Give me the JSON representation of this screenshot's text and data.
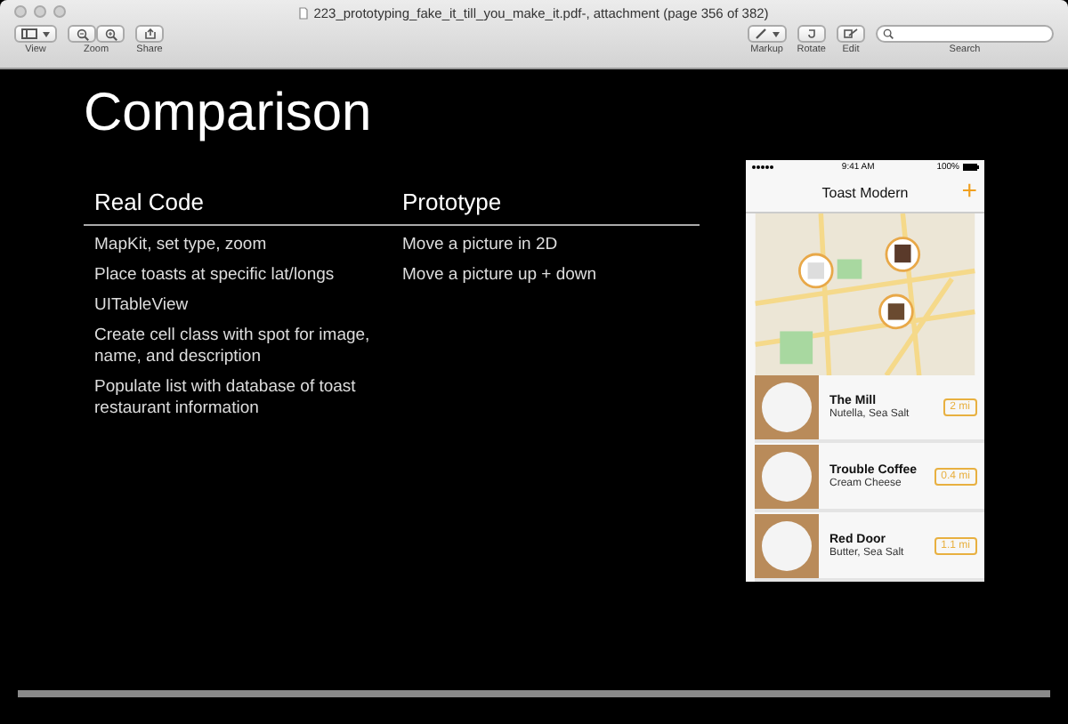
{
  "window": {
    "title": "223_prototyping_fake_it_till_you_make_it.pdf-, attachment (page 356 of 382)"
  },
  "toolbar": {
    "left": [
      {
        "kind": "view",
        "label": "View"
      },
      {
        "kind": "zoom",
        "label": "Zoom"
      },
      {
        "kind": "share",
        "label": "Share"
      }
    ],
    "right": [
      {
        "kind": "markup",
        "label": "Markup"
      },
      {
        "kind": "rotate",
        "label": "Rotate"
      },
      {
        "kind": "edit",
        "label": "Edit"
      }
    ],
    "search": {
      "label": "Search"
    }
  },
  "slide": {
    "title": "Comparison",
    "columns": [
      {
        "heading": "Real Code",
        "items": [
          "MapKit, set type, zoom",
          "Place toasts at specific lat/longs",
          "UITableView",
          "Create cell class with spot for image, name, and description",
          "Populate list with database of toast restaurant information"
        ]
      },
      {
        "heading": "Prototype",
        "items": [
          "Move a picture in 2D",
          "Move a picture up + down"
        ]
      }
    ],
    "phone": {
      "time": "9:41 AM",
      "battery": "100%",
      "title": "Toast Modern",
      "add": "+",
      "rows": [
        {
          "name": "The Mill",
          "description": "Nutella, Sea Salt",
          "distance": "2 mi"
        },
        {
          "name": "Trouble Coffee",
          "description": "Cream Cheese",
          "distance": "0.4 mi"
        },
        {
          "name": "Red Door",
          "description": "Butter, Sea Salt",
          "distance": "1.1 mi"
        }
      ]
    }
  }
}
